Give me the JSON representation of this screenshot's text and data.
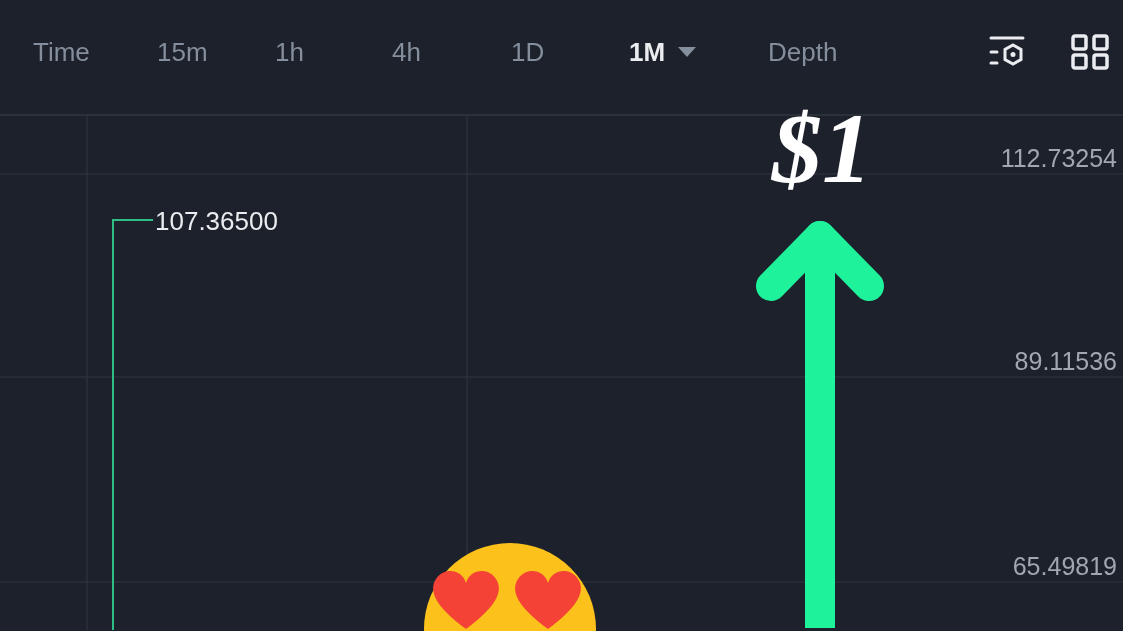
{
  "toolbar": {
    "tabs": [
      {
        "label": "Time",
        "selected": false,
        "dropdown": false
      },
      {
        "label": "15m",
        "selected": false,
        "dropdown": false
      },
      {
        "label": "1h",
        "selected": false,
        "dropdown": false
      },
      {
        "label": "4h",
        "selected": false,
        "dropdown": false
      },
      {
        "label": "1D",
        "selected": false,
        "dropdown": false
      },
      {
        "label": "1M",
        "selected": true,
        "dropdown": true
      },
      {
        "label": "Depth",
        "selected": false,
        "dropdown": false
      }
    ]
  },
  "chart": {
    "price_axis": [
      "112.73254",
      "89.11536",
      "65.49819"
    ],
    "high_marker": "107.36500"
  },
  "overlay": {
    "caption": "$1"
  }
}
